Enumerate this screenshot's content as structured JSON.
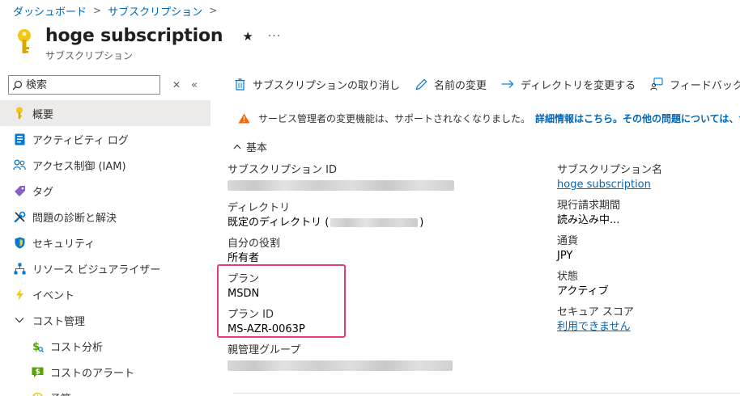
{
  "breadcrumb": [
    {
      "label": "ダッシュボード"
    },
    {
      "label": "サブスクリプション"
    }
  ],
  "header": {
    "title": "hoge subscription",
    "subtitle": "サブスクリプション",
    "star": "★",
    "more": "···"
  },
  "sidebar": {
    "search_placeholder": "検索",
    "collapse_glyph": "«",
    "clear_glyph": "⌄",
    "items": [
      {
        "label": "概要",
        "icon": "key-icon",
        "active": true
      },
      {
        "label": "アクティビティ ログ",
        "icon": "activity-log-icon"
      },
      {
        "label": "アクセス制御 (IAM)",
        "icon": "people-icon"
      },
      {
        "label": "タグ",
        "icon": "tag-icon"
      },
      {
        "label": "問題の診断と解決",
        "icon": "wrench-icon"
      },
      {
        "label": "セキュリティ",
        "icon": "shield-icon"
      },
      {
        "label": "リソース ビジュアライザー",
        "icon": "hierarchy-icon"
      },
      {
        "label": "イベント",
        "icon": "lightning-icon"
      },
      {
        "label": "コスト管理",
        "icon": "chevron-down-icon"
      },
      {
        "label": "コスト分析",
        "icon": "cost-analysis-icon"
      },
      {
        "label": "コストのアラート",
        "icon": "cost-alert-icon"
      },
      {
        "label": "予算",
        "icon": "budget-icon"
      }
    ]
  },
  "toolbar": {
    "cancel_label": "サブスクリプションの取り消し",
    "rename_label": "名前の変更",
    "change_dir_label": "ディレクトリを変更する",
    "feedback_label": "フィードバック"
  },
  "warning": {
    "text": "サービス管理者の変更機能は、サポートされなくなりました。",
    "link": "詳細情報はこちら。その他の問題については、サ"
  },
  "essentials": {
    "heading": "基本",
    "left": {
      "sub_id_label": "サブスクリプション ID",
      "directory_label": "ディレクトリ",
      "directory_value_prefix": "既定のディレクトリ (",
      "directory_value_suffix": ")",
      "role_label": "自分の役割",
      "role_value": "所有者",
      "plan_label": "プラン",
      "plan_value": "MSDN",
      "plan_id_label": "プラン ID",
      "plan_id_value": "MS-AZR-0063P",
      "parent_group_label": "親管理グループ"
    },
    "right": {
      "sub_name_label": "サブスクリプション名",
      "sub_name_value": "hoge subscription",
      "billing_label": "現行請求期間",
      "billing_value": "読み込み中...",
      "currency_label": "通貨",
      "currency_value": "JPY",
      "status_label": "状態",
      "status_value": "アクティブ",
      "score_label": "セキュア スコア",
      "score_value": "利用できません"
    }
  },
  "colors": {
    "link": "#0067b8",
    "highlight": "#e8397f",
    "key": "#f2c811",
    "warning": "#f7630c"
  }
}
